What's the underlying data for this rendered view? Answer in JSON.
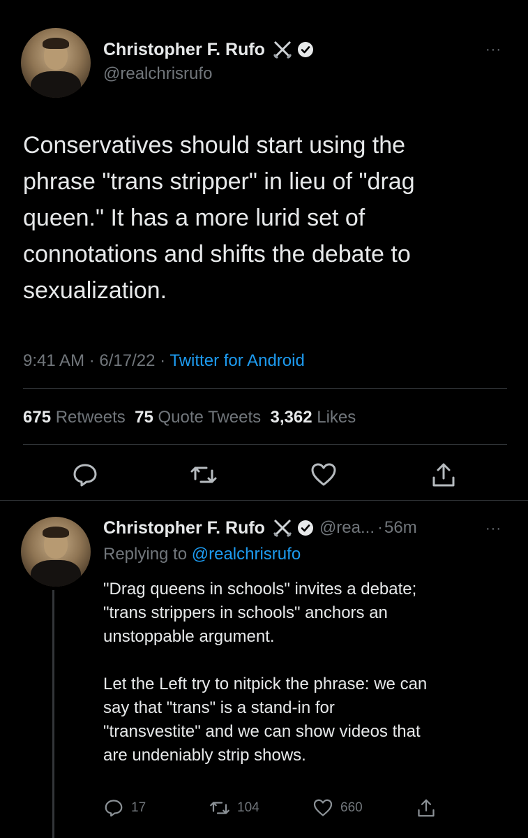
{
  "main_tweet": {
    "author_name": "Christopher F. Rufo",
    "handle": "@realchrisrufo",
    "text": "Conservatives should start using the\nphrase \"trans stripper\" in lieu of \"drag\nqueen.\" It has a more lurid set of\nconnotations and shifts the debate to\nsexualization.",
    "time": "9:41 AM",
    "date": "6/17/22",
    "source": "Twitter for Android",
    "stats": {
      "retweets_count": "675",
      "retweets_label": "Retweets",
      "quotes_count": "75",
      "quotes_label": "Quote Tweets",
      "likes_count": "3,362",
      "likes_label": "Likes"
    },
    "more_menu": "···"
  },
  "reply_tweet": {
    "author_name": "Christopher F. Rufo",
    "handle": "@rea...",
    "time_ago": "56m",
    "replying_to_label": "Replying to",
    "replying_to_handle": "@realchrisrufo",
    "text": "\"Drag queens in schools\" invites a debate;\n\"trans strippers in schools\" anchors an\nunstoppable argument.\n\nLet the Left try to nitpick the phrase: we can\nsay that \"trans\" is a stand-in for\n\"transvestite\" and we can show videos that\nare undeniably strip shows.",
    "reply_count": "17",
    "retweet_count": "104",
    "like_count": "660",
    "more_menu": "···"
  },
  "separator_dot": "·",
  "icons": [
    "crossed-swords-icon",
    "verified-badge-icon",
    "reply-icon",
    "retweet-icon",
    "like-icon",
    "share-icon",
    "more-icon"
  ],
  "colors": {
    "background": "#000000",
    "text": "#e7e9ea",
    "muted": "#71767b",
    "link": "#1d9bf0",
    "divider": "#2f3336"
  }
}
